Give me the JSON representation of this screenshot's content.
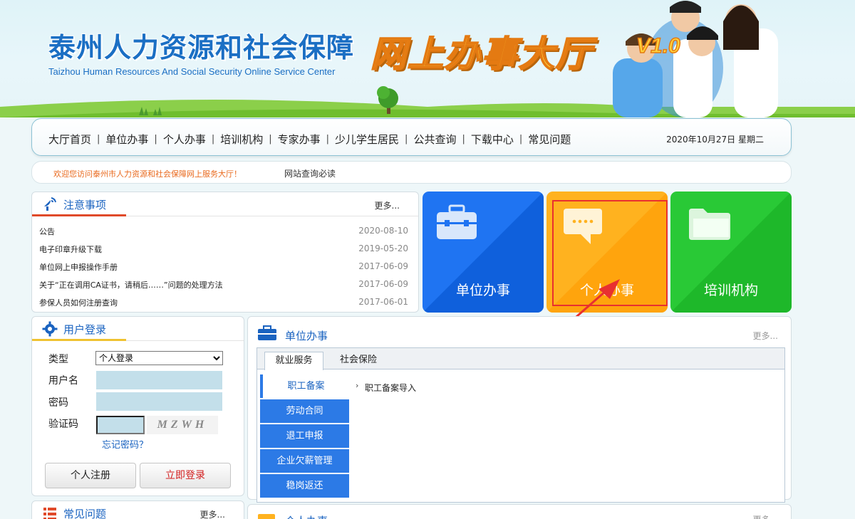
{
  "banner": {
    "site_title": "泰州人力资源和社会保障",
    "site_subtitle": "Taizhou Human Resources And Social Security Online Service Center",
    "hall_title": "网上办事大厅",
    "version": "V1.0"
  },
  "nav": {
    "items": [
      "大厅首页",
      "单位办事",
      "个人办事",
      "培训机构",
      "专家办事",
      "少儿学生居民",
      "公共查询",
      "下载中心",
      "常见问题"
    ],
    "separator": "|",
    "date": "2020年10月27日 星期二"
  },
  "noticebar": {
    "welcome": "欢迎您访问泰州市人力资源和社会保障网上服务大厅！",
    "must_read": "网站查询必读"
  },
  "notices": {
    "title": "注意事项",
    "more": "更多...",
    "items": [
      {
        "title": "公告",
        "date": "2020-08-10"
      },
      {
        "title": "电子印章升级下载",
        "date": "2019-05-20"
      },
      {
        "title": "单位网上申报操作手册",
        "date": "2017-06-09"
      },
      {
        "title": "关于“正在调用CA证书，请稍后……”问题的处理方法",
        "date": "2017-06-09"
      },
      {
        "title": "参保人员如何注册查询",
        "date": "2017-06-01"
      }
    ]
  },
  "tiles": [
    {
      "label": "单位办事",
      "icon": "briefcase-icon",
      "color": "#1f74f2"
    },
    {
      "label": "个人办事",
      "icon": "chat-bubble-icon",
      "color": "#ffb21f"
    },
    {
      "label": "培训机构",
      "icon": "folder-icon",
      "color": "#29c936"
    }
  ],
  "login": {
    "title": "用户登录",
    "type_label": "类型",
    "type_value": "个人登录",
    "username_label": "用户名",
    "password_label": "密码",
    "captcha_label": "验证码",
    "captcha_text": "MZWH",
    "forgot": "忘记密码？",
    "register": "个人注册",
    "login_now": "立即登录"
  },
  "unit_service": {
    "title": "单位办事",
    "more": "更多...",
    "tabs": [
      "就业服务",
      "社会保险"
    ],
    "side_menu": [
      "职工备案",
      "劳动合同",
      "退工申报",
      "企业欠薪管理",
      "稳岗返还"
    ],
    "sub_items": [
      "职工备案导入"
    ]
  },
  "faq": {
    "title": "常见问题",
    "more": "更多..."
  },
  "personal_service": {
    "title": "个人办事",
    "more": "更多..."
  }
}
